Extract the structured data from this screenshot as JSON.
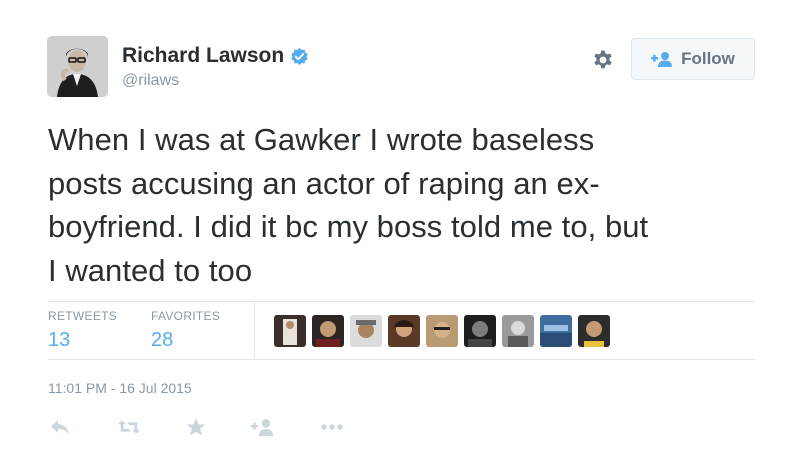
{
  "user": {
    "display_name": "Richard Lawson",
    "screen_name": "@rilaws",
    "verified": true
  },
  "follow_button": {
    "label": "Follow",
    "icon": "follow-user-icon"
  },
  "settings_icon": "gear-icon",
  "tweet": {
    "text": "When I was at Gawker I wrote baseless\nposts accusing an actor of raping an ex-\nboyfriend. I did it bc my boss told me to, but\nI wanted to too"
  },
  "stats": {
    "retweets_label": "RETWEETS",
    "retweets_value": "13",
    "favorites_label": "FAVORITES",
    "favorites_value": "28"
  },
  "favoriters_facepile_count": 9,
  "timestamp": "11:01 PM - 16 Jul 2015",
  "actions": [
    "reply-icon",
    "retweet-icon",
    "favorite-star-icon",
    "follow-user-icon",
    "more-dots-icon"
  ],
  "colors": {
    "text": "#292f33",
    "muted": "#8899a6",
    "accent": "#55acee",
    "border": "#e1e8ed",
    "action_icon": "#ccd6dd"
  }
}
